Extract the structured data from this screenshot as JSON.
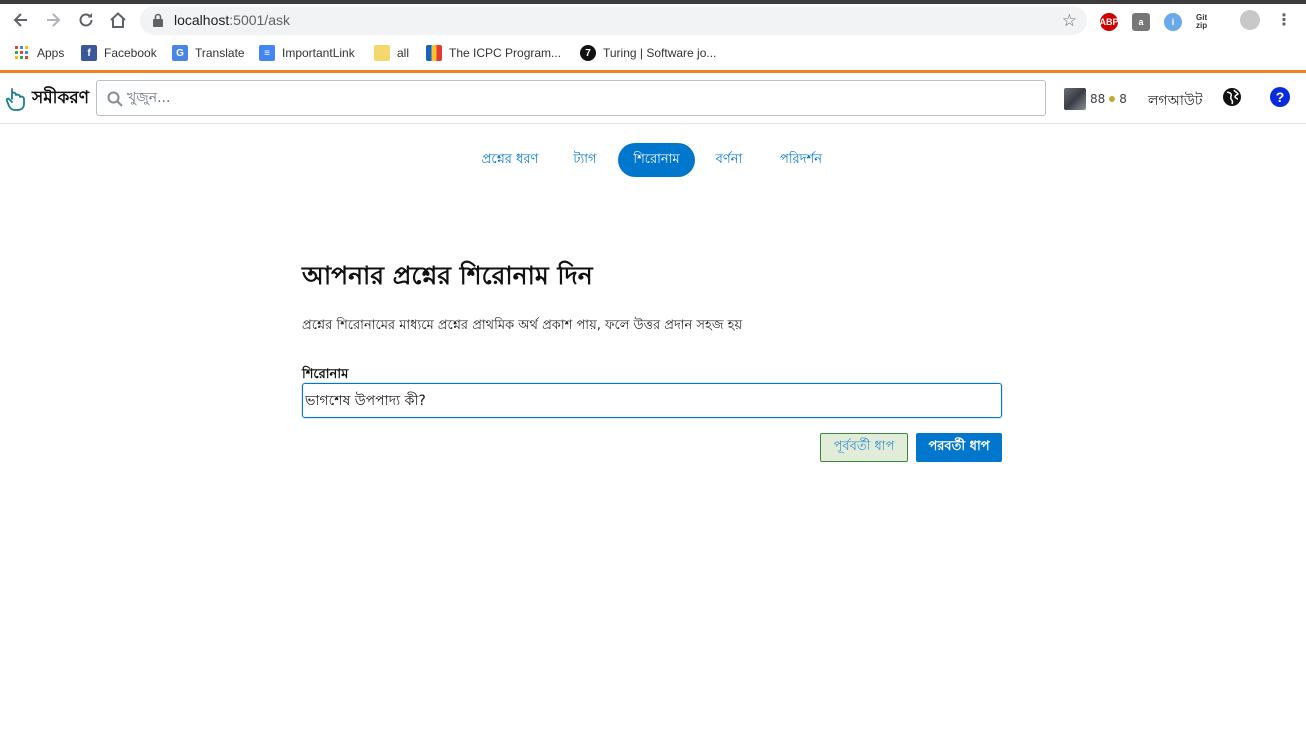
{
  "browser": {
    "url_host": "localhost",
    "url_path": ":5001/ask",
    "bookmarks": [
      {
        "label": "Apps"
      },
      {
        "label": "Facebook"
      },
      {
        "label": "Translate"
      },
      {
        "label": "ImportantLink"
      },
      {
        "label": "all"
      },
      {
        "label": "The ICPC Program..."
      },
      {
        "label": "Turing | Software jo..."
      }
    ],
    "extensions": [
      "ABP",
      "a",
      "i",
      "Git zip"
    ]
  },
  "header": {
    "logo_text": "সমীকরণ",
    "search_placeholder": "খুজুন...",
    "reputation": "88",
    "badge_count": "8",
    "logout_label": "লগআউট",
    "help_label": "?"
  },
  "steps": [
    {
      "label": "প্রশ্নের ধরণ"
    },
    {
      "label": "ট্যাগ"
    },
    {
      "label": "শিরোনাম"
    },
    {
      "label": "বর্ণনা"
    },
    {
      "label": "পরিদর্শন"
    }
  ],
  "main": {
    "title": "আপনার প্রশ্নের শিরোনাম দিন",
    "description": "প্রশ্নের শিরোনামের মাধ্যমে প্রশ্নের প্রাথমিক অর্থ প্রকাশ পায়, ফলে উত্তর প্রদান সহজ হয়",
    "field_label": "শিরোনাম",
    "field_value": "ভাগশেষ উপপাদ্য কী?",
    "prev_button": "পূর্ববর্তী ধাপ",
    "next_button": "পরবর্তী ধাপ"
  },
  "colors": {
    "accent": "#0077cc",
    "header_top_border": "#f48024",
    "prev_button_bg": "#e1ecd9"
  }
}
